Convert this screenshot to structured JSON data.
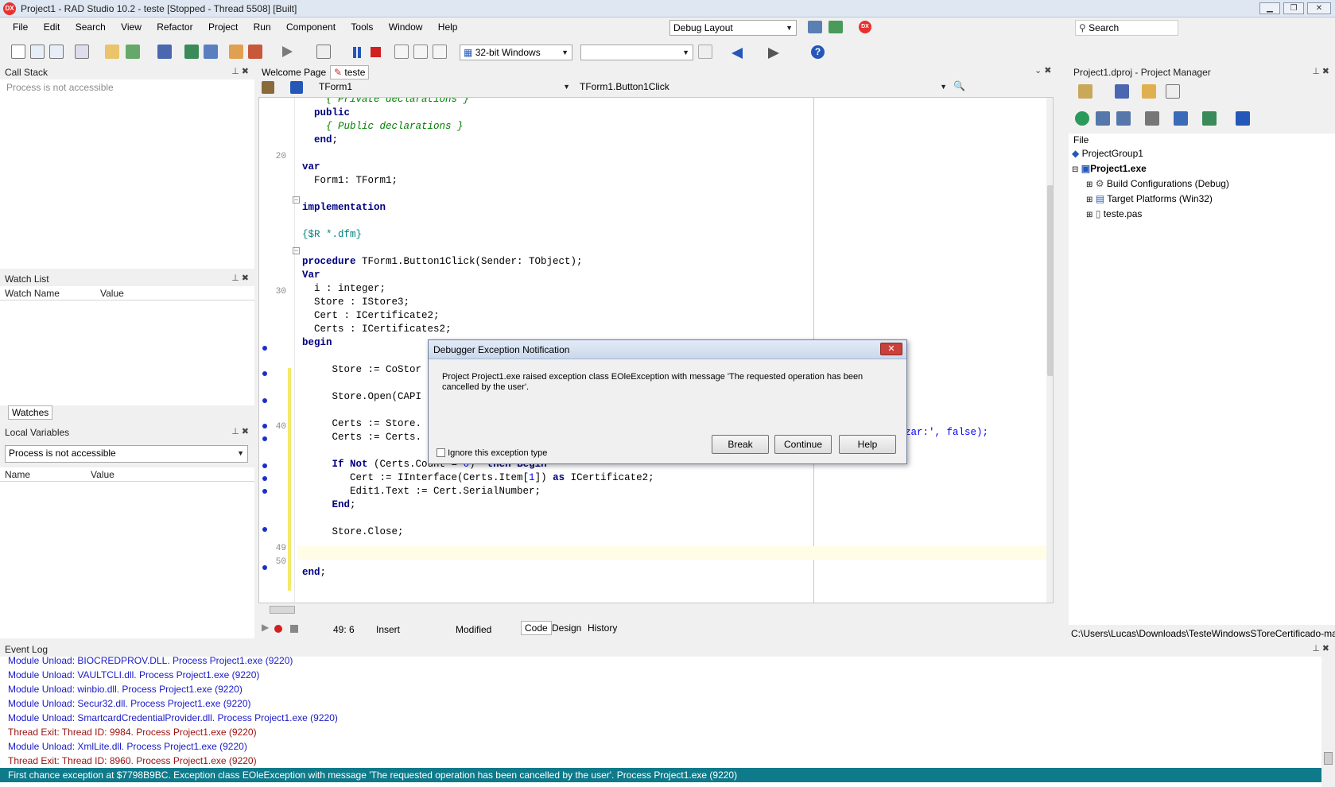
{
  "window": {
    "title": "Project1 - RAD Studio 10.2 - teste [Stopped - Thread 5508] [Built]",
    "app_icon": "DX"
  },
  "menu": [
    "File",
    "Edit",
    "Search",
    "View",
    "Refactor",
    "Project",
    "Run",
    "Component",
    "Tools",
    "Window",
    "Help"
  ],
  "layout_combo": "Debug Layout",
  "search_placeholder": "Search",
  "platform_combo": "32-bit Windows",
  "call_stack": {
    "title": "Call Stack",
    "status": "Process is not accessible"
  },
  "watch_list": {
    "title": "Watch List",
    "col_name": "Watch Name",
    "col_value": "Value",
    "tab": "Watches"
  },
  "local_vars": {
    "title": "Local Variables",
    "combo": "Process is not accessible",
    "col_name": "Name",
    "col_value": "Value"
  },
  "editor": {
    "tabs": [
      "Welcome Page",
      "teste"
    ],
    "class_combo": "TForm1",
    "method_combo": "TForm1.Button1Click",
    "status": {
      "position": "49:  6",
      "mode": "Insert",
      "modified": "Modified"
    },
    "bottom_tabs": [
      "Code",
      "Design",
      "History"
    ],
    "line_numbers": {
      "l20": "20",
      "l30": "30",
      "l40": "40",
      "l49": "49",
      "l50": "50"
    },
    "code_fragment": "zar:', false);"
  },
  "project_manager": {
    "title": "Project1.dproj - Project Manager",
    "col_file": "File",
    "group": "ProjectGroup1",
    "project": "Project1.exe",
    "children": [
      "Build Configurations (Debug)",
      "Target Platforms (Win32)",
      "teste.pas"
    ],
    "path": "C:\\Users\\Lucas\\Downloads\\TesteWindowsSToreCertificado-ma"
  },
  "dialog": {
    "title": "Debugger Exception Notification",
    "message": "Project Project1.exe raised exception class EOleException with message 'The requested operation has been cancelled by the user'.",
    "checkbox": "Ignore this exception type",
    "buttons": [
      "Break",
      "Continue",
      "Help"
    ]
  },
  "event_log": {
    "title": "Event Log",
    "lines": [
      {
        "text": "Module Unload: BIOCREDPROV.DLL. Process Project1.exe (9220)",
        "color": "#1a1ac8"
      },
      {
        "text": "Module Unload: VAULTCLI.dll. Process Project1.exe (9220)",
        "color": "#1a1ac8"
      },
      {
        "text": "Module Unload: winbio.dll. Process Project1.exe (9220)",
        "color": "#1a1ac8"
      },
      {
        "text": "Module Unload: Secur32.dll. Process Project1.exe (9220)",
        "color": "#1a1ac8"
      },
      {
        "text": "Module Unload: SmartcardCredentialProvider.dll. Process Project1.exe (9220)",
        "color": "#1a1ac8"
      },
      {
        "text": "Thread Exit: Thread ID: 9984. Process Project1.exe (9220)",
        "color": "#9b1010"
      },
      {
        "text": "Module Unload: XmlLite.dll. Process Project1.exe (9220)",
        "color": "#1a1ac8"
      },
      {
        "text": "Thread Exit: Thread ID: 8960. Process Project1.exe (9220)",
        "color": "#9b1010"
      }
    ],
    "selected": "First chance exception at $7798B9BC. Exception class EOleException with message 'The requested operation has been cancelled by the user'. Process Project1.exe (9220)"
  }
}
